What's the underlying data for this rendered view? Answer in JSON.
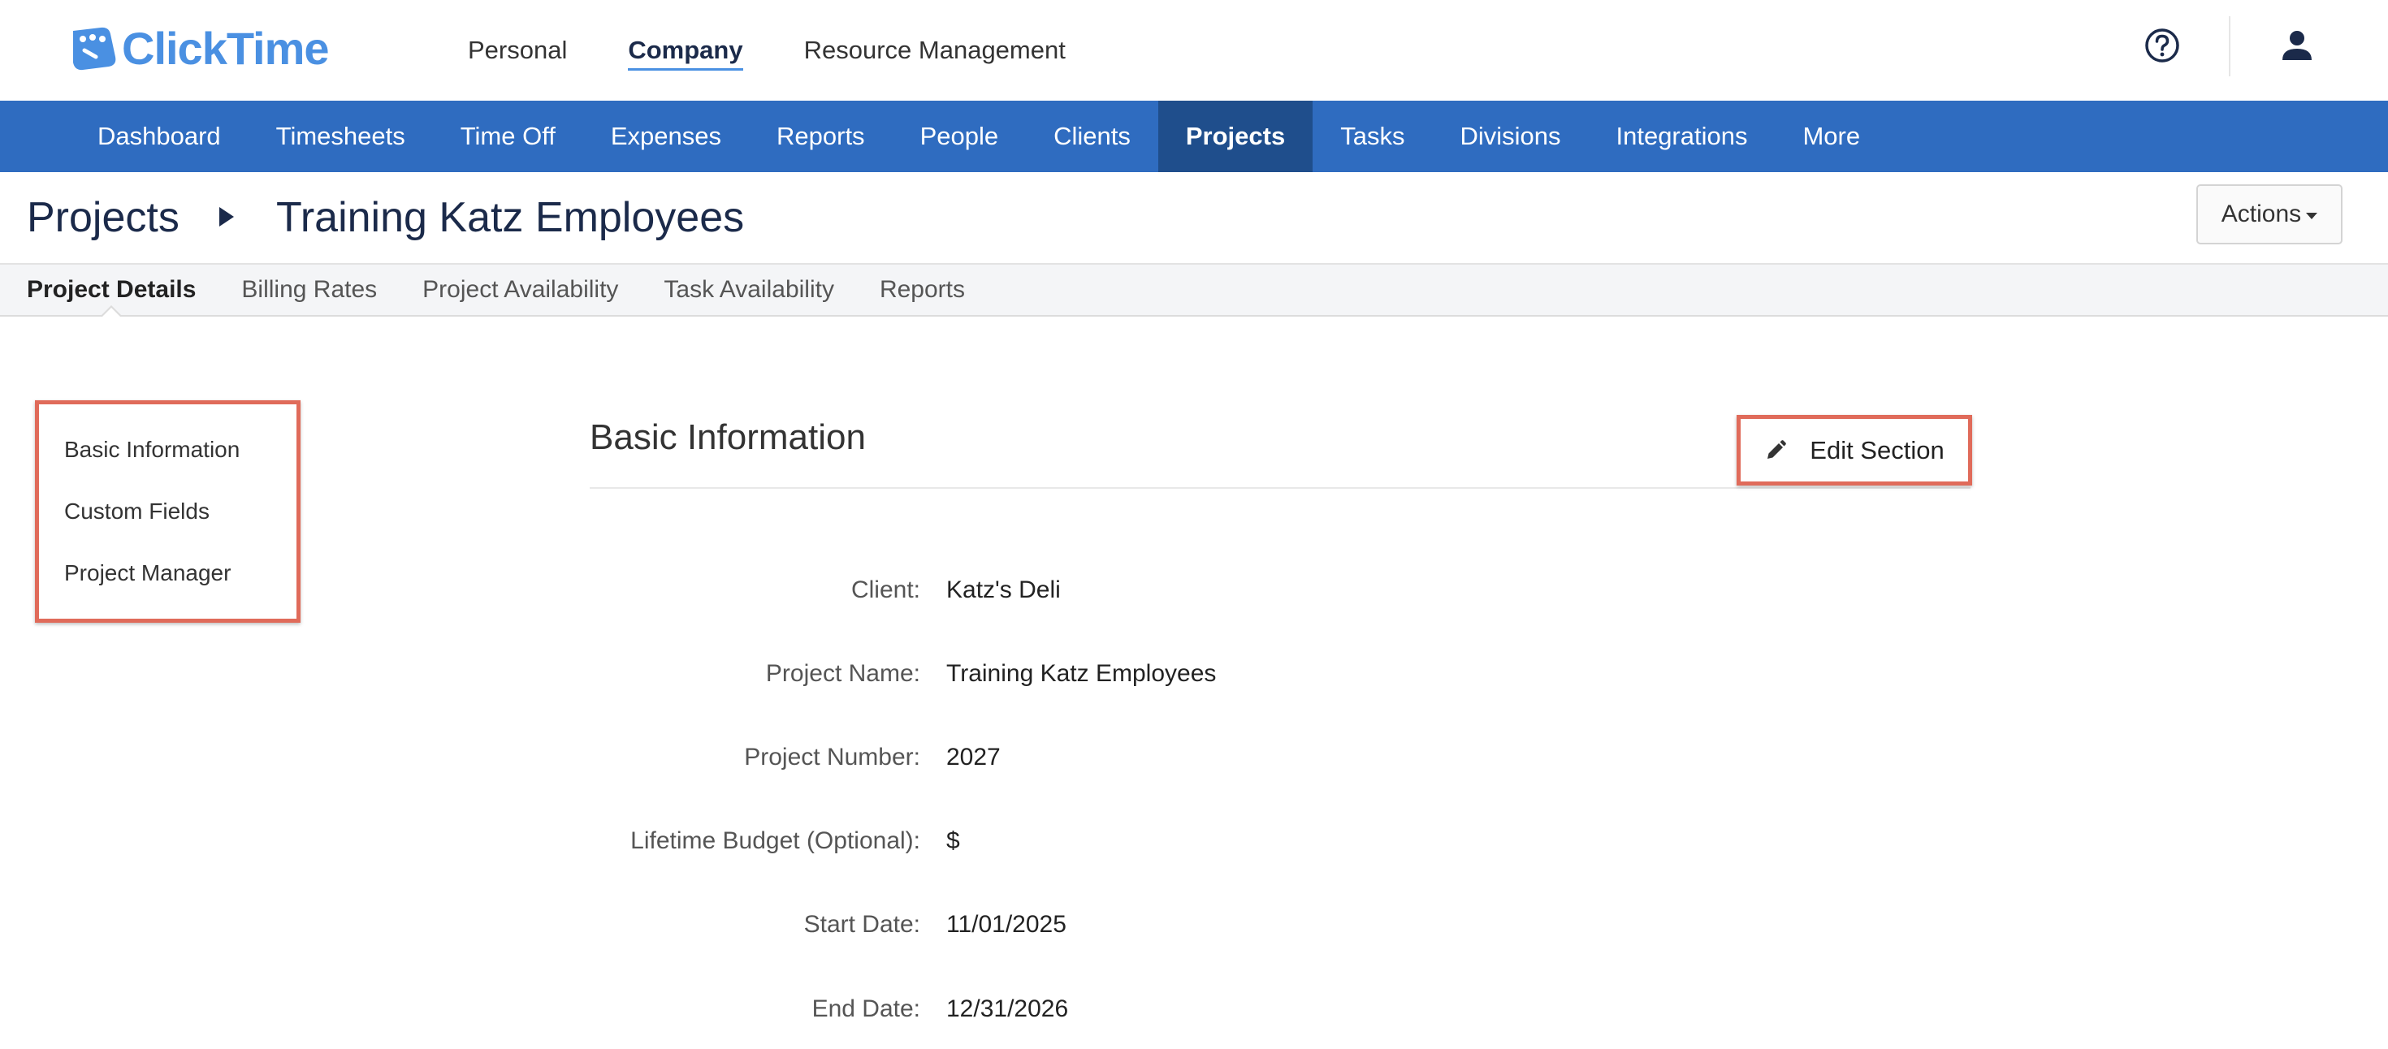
{
  "app": {
    "logo_text": "ClickTime"
  },
  "top_nav": {
    "items": [
      {
        "label": "Personal"
      },
      {
        "label": "Company"
      },
      {
        "label": "Resource Management"
      }
    ]
  },
  "header_icons": {
    "help": "question-circle-icon",
    "user": "user-icon"
  },
  "main_nav": {
    "items": [
      {
        "label": "Dashboard"
      },
      {
        "label": "Timesheets"
      },
      {
        "label": "Time Off"
      },
      {
        "label": "Expenses"
      },
      {
        "label": "Reports"
      },
      {
        "label": "People"
      },
      {
        "label": "Clients"
      },
      {
        "label": "Projects"
      },
      {
        "label": "Tasks"
      },
      {
        "label": "Divisions"
      },
      {
        "label": "Integrations"
      },
      {
        "label": "More"
      }
    ],
    "active": "Projects"
  },
  "breadcrumb": {
    "root": "Projects",
    "current": "Training Katz Employees"
  },
  "actions_label": "Actions",
  "sub_tabs": [
    {
      "label": "Project Details"
    },
    {
      "label": "Billing Rates"
    },
    {
      "label": "Project Availability"
    },
    {
      "label": "Task Availability"
    },
    {
      "label": "Reports"
    }
  ],
  "section_nav": [
    {
      "label": "Basic Information"
    },
    {
      "label": "Custom Fields"
    },
    {
      "label": "Project Manager"
    }
  ],
  "section": {
    "heading": "Basic Information",
    "edit_label": "Edit Section",
    "fields": [
      {
        "label": "Client:",
        "value": "Katz's Deli"
      },
      {
        "label": "Project Name:",
        "value": "Training Katz Employees"
      },
      {
        "label": "Project Number:",
        "value": "2027"
      },
      {
        "label": "Lifetime Budget (Optional):",
        "value": "$"
      },
      {
        "label": "Start Date:",
        "value": "11/01/2025"
      },
      {
        "label": "End Date:",
        "value": "12/31/2026"
      }
    ]
  },
  "colors": {
    "brand_blue": "#4a90e2",
    "nav_blue": "#2f6cc0",
    "nav_active": "#1f4e8c",
    "highlight_red": "#e06b5a"
  }
}
